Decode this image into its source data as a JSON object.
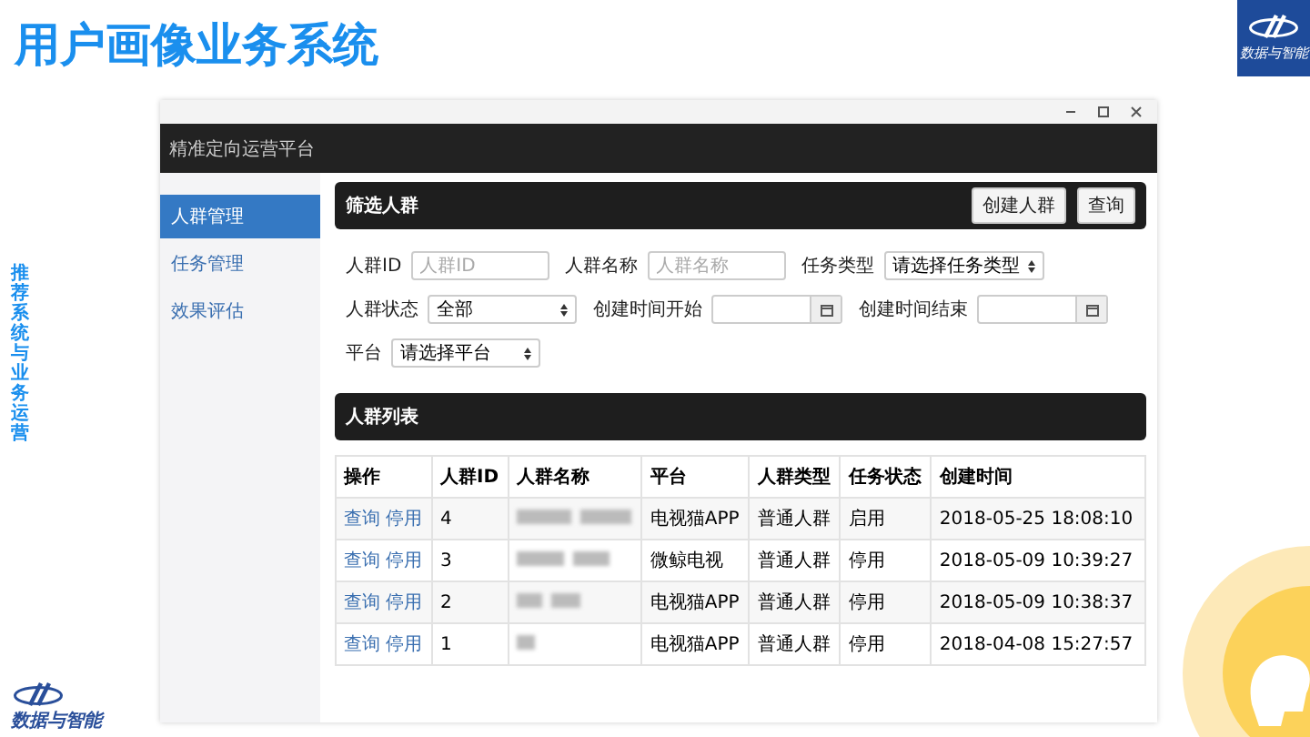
{
  "slide": {
    "title": "用户画像业务系统",
    "side_caption": "推荐系统与业务运营",
    "logo_text": "数据与智能",
    "footer_logo_text": "数据与智能"
  },
  "window": {
    "title": "精准定向运营平台"
  },
  "sidebar": {
    "items": [
      {
        "label": "人群管理",
        "selected": true
      },
      {
        "label": "任务管理",
        "selected": false
      },
      {
        "label": "效果评估",
        "selected": false
      }
    ]
  },
  "filter": {
    "title": "筛选人群",
    "buttons": [
      "创建人群",
      "查询"
    ],
    "rows": [
      [
        {
          "label": "人群ID",
          "kind": "input",
          "placeholder": "人群ID"
        },
        {
          "label": "人群名称",
          "kind": "input",
          "placeholder": "人群名称"
        },
        {
          "label": "任务类型",
          "kind": "select",
          "value": "请选择任务类型"
        }
      ],
      [
        {
          "label": "人群状态",
          "kind": "select",
          "value": "全部"
        },
        {
          "label": "创建时间开始",
          "kind": "date"
        },
        {
          "label": "创建时间结束",
          "kind": "date"
        }
      ],
      [
        {
          "label": "平台",
          "kind": "select",
          "value": "请选择平台"
        }
      ]
    ]
  },
  "list": {
    "title": "人群列表",
    "columns": [
      "操作",
      "人群ID",
      "人群名称",
      "平台",
      "人群类型",
      "任务状态",
      "创建时间"
    ],
    "rows": [
      {
        "actions": [
          "查询",
          "停用"
        ],
        "id": "4",
        "platform": "电视猫APP",
        "type": "普通人群",
        "status": "启用",
        "created": "2018-05-25 18:08:10"
      },
      {
        "actions": [
          "查询",
          "停用"
        ],
        "id": "3",
        "platform": "微鲸电视",
        "type": "普通人群",
        "status": "停用",
        "created": "2018-05-09 10:39:27"
      },
      {
        "actions": [
          "查询",
          "停用"
        ],
        "id": "2",
        "platform": "电视猫APP",
        "type": "普通人群",
        "status": "停用",
        "created": "2018-05-09 10:38:37"
      },
      {
        "actions": [
          "查询",
          "停用"
        ],
        "id": "1",
        "platform": "电视猫APP",
        "type": "普通人群",
        "status": "停用",
        "created": "2018-04-08 15:27:57"
      }
    ]
  }
}
